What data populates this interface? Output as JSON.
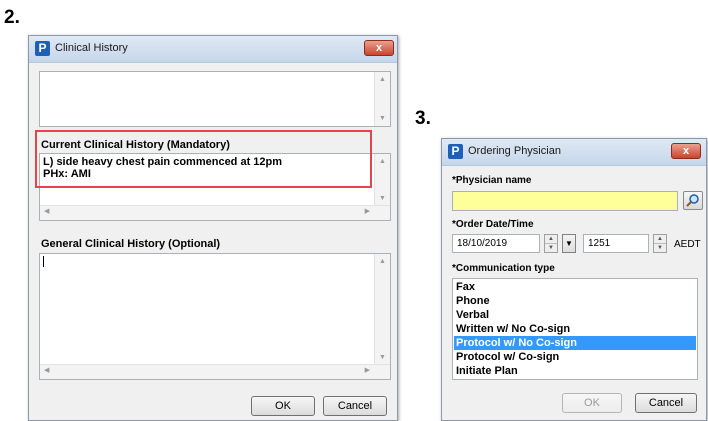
{
  "steps": {
    "left": "2.",
    "right": "3."
  },
  "clinical_history": {
    "title": "Clinical History",
    "close_label": "x",
    "current_label": "Current Clinical History (Mandatory)",
    "current_text": "L) side heavy chest pain commenced at 12pm\nPHx: AMI",
    "general_label": "General Clinical History (Optional)",
    "general_text": "",
    "ok_label": "OK",
    "cancel_label": "Cancel"
  },
  "ordering_physician": {
    "title": "Ordering Physician",
    "close_label": "x",
    "physician_label": "*Physician name",
    "physician_value": "",
    "date_label": "*Order Date/Time",
    "date_value": "18/10/2019",
    "time_value": "1251",
    "timezone": "AEDT",
    "comm_label": "*Communication type",
    "comm_options": [
      "Fax",
      "Phone",
      "Verbal",
      "Written w/ No Co-sign",
      "Protocol w/ No Co-sign",
      "Protocol w/ Co-sign",
      "Initiate Plan"
    ],
    "comm_selected": "Protocol w/ No Co-sign",
    "ok_label": "OK",
    "cancel_label": "Cancel"
  },
  "colors": {
    "highlight": "#e0474c",
    "selection": "#3399ff",
    "required_field": "#ffff99"
  },
  "icons": [
    "app-p-icon",
    "close-icon",
    "magnifier-icon",
    "spin-up-icon",
    "spin-down-icon",
    "dropdown-arrow-icon"
  ]
}
